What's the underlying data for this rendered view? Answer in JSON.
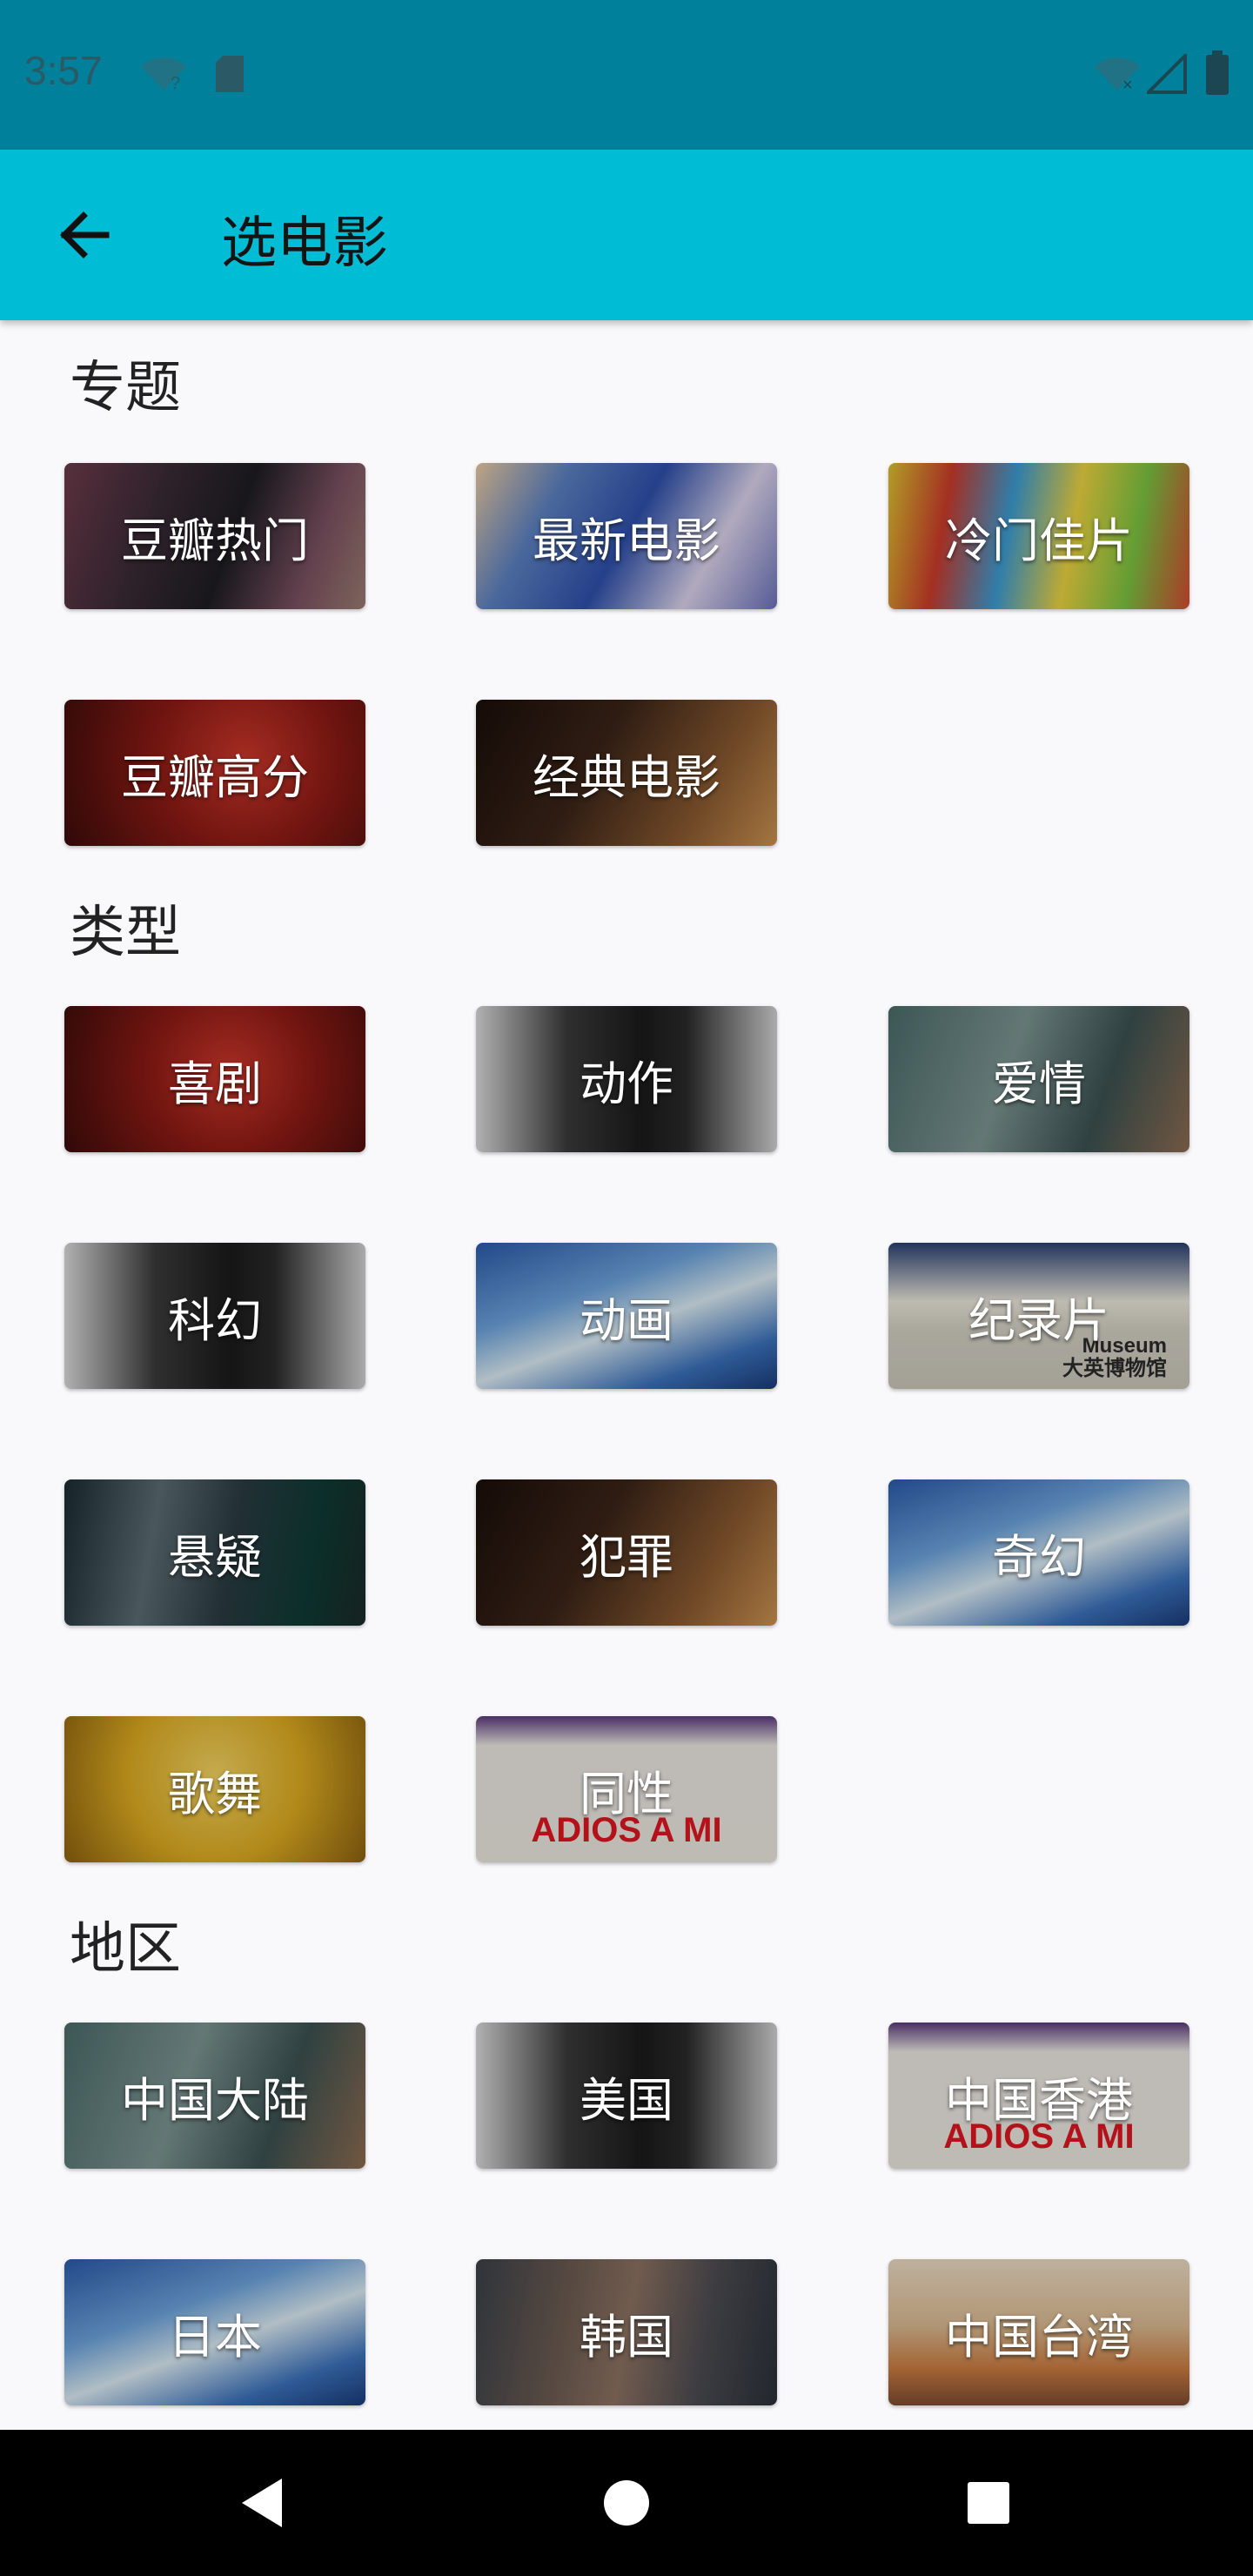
{
  "status_bar": {
    "time": "3:57"
  },
  "app_bar": {
    "title": "选电影"
  },
  "sections": [
    {
      "title": "专题",
      "items": [
        {
          "label": "豆瓣热门",
          "style": "mixed-dark"
        },
        {
          "label": "最新电影",
          "style": "anime-blue"
        },
        {
          "label": "冷门佳片",
          "style": "colorful"
        },
        {
          "label": "豆瓣高分",
          "style": "red"
        },
        {
          "label": "经典电影",
          "style": "dark-brown"
        }
      ]
    },
    {
      "title": "类型",
      "items": [
        {
          "label": "喜剧",
          "style": "red"
        },
        {
          "label": "动作",
          "style": "grey-bw"
        },
        {
          "label": "爱情",
          "style": "teal-grey"
        },
        {
          "label": "科幻",
          "style": "grey-bw"
        },
        {
          "label": "动画",
          "style": "sky-blue"
        },
        {
          "label": "纪录片",
          "style": "wave"
        },
        {
          "label": "悬疑",
          "style": "dark-teal"
        },
        {
          "label": "犯罪",
          "style": "dark-brown"
        },
        {
          "label": "奇幻",
          "style": "sky-blue"
        },
        {
          "label": "歌舞",
          "style": "yellow"
        },
        {
          "label": "同性",
          "style": "poster-white"
        }
      ]
    },
    {
      "title": "地区",
      "items": [
        {
          "label": "中国大陆",
          "style": "teal-grey"
        },
        {
          "label": "美国",
          "style": "grey-bw"
        },
        {
          "label": "中国香港",
          "style": "poster-white"
        },
        {
          "label": "日本",
          "style": "sky-blue"
        },
        {
          "label": "韩国",
          "style": "grey-crowd"
        },
        {
          "label": "中国台湾",
          "style": "warm-orange"
        }
      ]
    }
  ],
  "poster_texts": {
    "adios": "ADIOS A MI",
    "museum_line1": "Museum",
    "museum_line2": "大英博物馆"
  },
  "colors": {
    "status_bar": "#00809a",
    "app_bar": "#00bcd4",
    "background": "#f9f9fb",
    "nav_bar": "#000000"
  },
  "icons": {
    "back": "arrow-left-icon",
    "nav_back": "triangle-back-icon",
    "nav_home": "circle-home-icon",
    "nav_recents": "square-recents-icon"
  }
}
